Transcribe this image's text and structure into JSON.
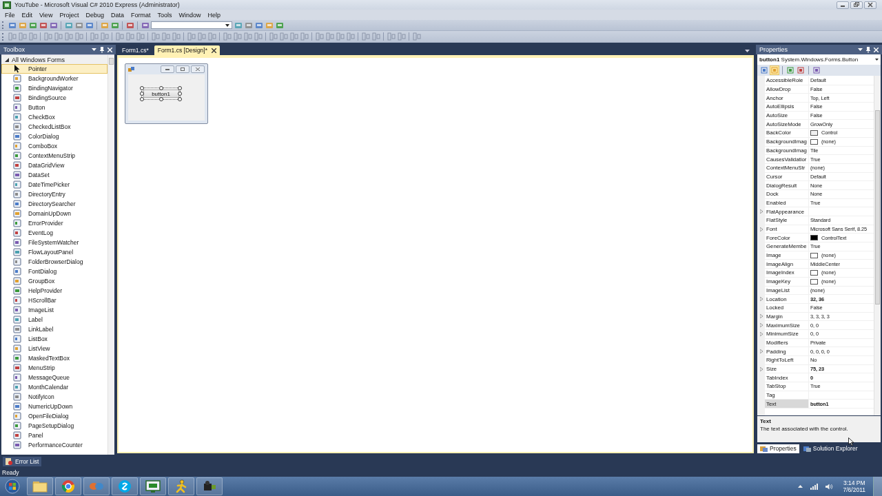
{
  "window": {
    "title": "YouTube - Microsoft Visual C# 2010 Express (Administrator)"
  },
  "menu": [
    "File",
    "Edit",
    "View",
    "Project",
    "Debug",
    "Data",
    "Format",
    "Tools",
    "Window",
    "Help"
  ],
  "toolbox": {
    "title": "Toolbox",
    "category": "All Windows Forms",
    "expanded": true,
    "items": [
      {
        "label": "Pointer",
        "selected": true
      },
      {
        "label": "BackgroundWorker",
        "selected": false
      },
      {
        "label": "BindingNavigator",
        "selected": false
      },
      {
        "label": "BindingSource",
        "selected": false
      },
      {
        "label": "Button",
        "selected": false
      },
      {
        "label": "CheckBox",
        "selected": false
      },
      {
        "label": "CheckedListBox",
        "selected": false
      },
      {
        "label": "ColorDialog",
        "selected": false
      },
      {
        "label": "ComboBox",
        "selected": false
      },
      {
        "label": "ContextMenuStrip",
        "selected": false
      },
      {
        "label": "DataGridView",
        "selected": false
      },
      {
        "label": "DataSet",
        "selected": false
      },
      {
        "label": "DateTimePicker",
        "selected": false
      },
      {
        "label": "DirectoryEntry",
        "selected": false
      },
      {
        "label": "DirectorySearcher",
        "selected": false
      },
      {
        "label": "DomainUpDown",
        "selected": false
      },
      {
        "label": "ErrorProvider",
        "selected": false
      },
      {
        "label": "EventLog",
        "selected": false
      },
      {
        "label": "FileSystemWatcher",
        "selected": false
      },
      {
        "label": "FlowLayoutPanel",
        "selected": false
      },
      {
        "label": "FolderBrowserDialog",
        "selected": false
      },
      {
        "label": "FontDialog",
        "selected": false
      },
      {
        "label": "GroupBox",
        "selected": false
      },
      {
        "label": "HelpProvider",
        "selected": false
      },
      {
        "label": "HScrollBar",
        "selected": false
      },
      {
        "label": "ImageList",
        "selected": false
      },
      {
        "label": "Label",
        "selected": false
      },
      {
        "label": "LinkLabel",
        "selected": false
      },
      {
        "label": "ListBox",
        "selected": false
      },
      {
        "label": "ListView",
        "selected": false
      },
      {
        "label": "MaskedTextBox",
        "selected": false
      },
      {
        "label": "MenuStrip",
        "selected": false
      },
      {
        "label": "MessageQueue",
        "selected": false
      },
      {
        "label": "MonthCalendar",
        "selected": false
      },
      {
        "label": "NotifyIcon",
        "selected": false
      },
      {
        "label": "NumericUpDown",
        "selected": false
      },
      {
        "label": "OpenFileDialog",
        "selected": false
      },
      {
        "label": "PageSetupDialog",
        "selected": false
      },
      {
        "label": "Panel",
        "selected": false
      },
      {
        "label": "PerformanceCounter",
        "selected": false
      }
    ]
  },
  "tabs": [
    {
      "label": "Form1.cs*",
      "selected": false
    },
    {
      "label": "Form1.cs [Design]*",
      "selected": true
    }
  ],
  "designer": {
    "form_button": {
      "label": "button1",
      "selected": true
    }
  },
  "properties": {
    "title": "Properties",
    "object_name": "button1",
    "object_type": "System.Windows.Forms.Button",
    "rows": [
      {
        "name": "AccessibleRole",
        "value": "Default",
        "kind": "text",
        "expandable": false,
        "modified": false,
        "selected": false
      },
      {
        "name": "AllowDrop",
        "value": "False",
        "kind": "text",
        "expandable": false,
        "modified": false,
        "selected": false
      },
      {
        "name": "Anchor",
        "value": "Top, Left",
        "kind": "text",
        "expandable": false,
        "modified": false,
        "selected": false
      },
      {
        "name": "AutoEllipsis",
        "value": "False",
        "kind": "text",
        "expandable": false,
        "modified": false,
        "selected": false
      },
      {
        "name": "AutoSize",
        "value": "False",
        "kind": "text",
        "expandable": false,
        "modified": false,
        "selected": false
      },
      {
        "name": "AutoSizeMode",
        "value": "GrowOnly",
        "kind": "text",
        "expandable": false,
        "modified": false,
        "selected": false
      },
      {
        "name": "BackColor",
        "value": "Control",
        "kind": "swatch",
        "color": "#f0f0f0",
        "expandable": false,
        "modified": false,
        "selected": false
      },
      {
        "name": "BackgroundImag",
        "value": "(none)",
        "kind": "swatch",
        "color": "#ffffff",
        "expandable": false,
        "modified": false,
        "selected": false
      },
      {
        "name": "BackgroundImag",
        "value": "Tile",
        "kind": "text",
        "expandable": false,
        "modified": false,
        "selected": false
      },
      {
        "name": "CausesValidatior",
        "value": "True",
        "kind": "text",
        "expandable": false,
        "modified": false,
        "selected": false
      },
      {
        "name": "ContextMenuStr",
        "value": "(none)",
        "kind": "text",
        "expandable": false,
        "modified": false,
        "selected": false
      },
      {
        "name": "Cursor",
        "value": "Default",
        "kind": "text",
        "expandable": false,
        "modified": false,
        "selected": false
      },
      {
        "name": "DialogResult",
        "value": "None",
        "kind": "text",
        "expandable": false,
        "modified": false,
        "selected": false
      },
      {
        "name": "Dock",
        "value": "None",
        "kind": "text",
        "expandable": false,
        "modified": false,
        "selected": false
      },
      {
        "name": "Enabled",
        "value": "True",
        "kind": "text",
        "expandable": false,
        "modified": false,
        "selected": false
      },
      {
        "name": "FlatAppearance",
        "kind": "text",
        "expandable": true,
        "modified": false,
        "selected": false
      },
      {
        "name": "FlatStyle",
        "value": "Standard",
        "kind": "text",
        "expandable": false,
        "modified": false,
        "selected": false
      },
      {
        "name": "Font",
        "value": "Microsoft Sans Serif, 8.25",
        "kind": "text",
        "expandable": true,
        "modified": false,
        "selected": false
      },
      {
        "name": "ForeColor",
        "value": "ControlText",
        "kind": "swatch",
        "color": "#000000",
        "expandable": false,
        "modified": false,
        "selected": false
      },
      {
        "name": "GenerateMembe",
        "value": "True",
        "kind": "text",
        "expandable": false,
        "modified": false,
        "selected": false
      },
      {
        "name": "Image",
        "value": "(none)",
        "kind": "swatch",
        "color": "#ffffff",
        "expandable": false,
        "modified": false,
        "selected": false
      },
      {
        "name": "ImageAlign",
        "value": "MiddleCenter",
        "kind": "text",
        "expandable": false,
        "modified": false,
        "selected": false
      },
      {
        "name": "ImageIndex",
        "value": "(none)",
        "kind": "swatch",
        "color": "#ffffff",
        "expandable": false,
        "modified": false,
        "selected": false
      },
      {
        "name": "ImageKey",
        "value": "(none)",
        "kind": "swatch",
        "color": "#ffffff",
        "expandable": false,
        "modified": false,
        "selected": false
      },
      {
        "name": "ImageList",
        "value": "(none)",
        "kind": "text",
        "expandable": false,
        "modified": false,
        "selected": false
      },
      {
        "name": "Location",
        "value": "32, 36",
        "kind": "text",
        "expandable": true,
        "modified": true,
        "selected": false
      },
      {
        "name": "Locked",
        "value": "False",
        "kind": "text",
        "expandable": false,
        "modified": false,
        "selected": false
      },
      {
        "name": "Margin",
        "value": "3, 3, 3, 3",
        "kind": "text",
        "expandable": true,
        "modified": false,
        "selected": false
      },
      {
        "name": "MaximumSize",
        "value": "0, 0",
        "kind": "text",
        "expandable": true,
        "modified": false,
        "selected": false
      },
      {
        "name": "MinimumSize",
        "value": "0, 0",
        "kind": "text",
        "expandable": true,
        "modified": false,
        "selected": false
      },
      {
        "name": "Modifiers",
        "value": "Private",
        "kind": "text",
        "expandable": false,
        "modified": false,
        "selected": false
      },
      {
        "name": "Padding",
        "value": "0, 0, 0, 0",
        "kind": "text",
        "expandable": true,
        "modified": false,
        "selected": false
      },
      {
        "name": "RightToLeft",
        "value": "No",
        "kind": "text",
        "expandable": false,
        "modified": false,
        "selected": false
      },
      {
        "name": "Size",
        "value": "75, 23",
        "kind": "text",
        "expandable": true,
        "modified": true,
        "selected": false
      },
      {
        "name": "TabIndex",
        "value": "0",
        "kind": "text",
        "expandable": false,
        "modified": true,
        "selected": false
      },
      {
        "name": "TabStop",
        "value": "True",
        "kind": "text",
        "expandable": false,
        "modified": false,
        "selected": false
      },
      {
        "name": "Tag",
        "kind": "text",
        "expandable": false,
        "selected": false
      },
      {
        "name": "Text",
        "value": "button1",
        "kind": "text",
        "expandable": false,
        "modified": true,
        "selected": true
      }
    ],
    "description_title": "Text",
    "description": "The text associated with the control.",
    "tabs": [
      {
        "label": "Properties",
        "selected": true
      },
      {
        "label": "Solution Explorer",
        "selected": false
      }
    ]
  },
  "error_list": {
    "label": "Error List"
  },
  "status_bar": {
    "text": "Ready"
  },
  "taskbar": {
    "time": "3:14 PM",
    "date": "7/6/2011"
  }
}
